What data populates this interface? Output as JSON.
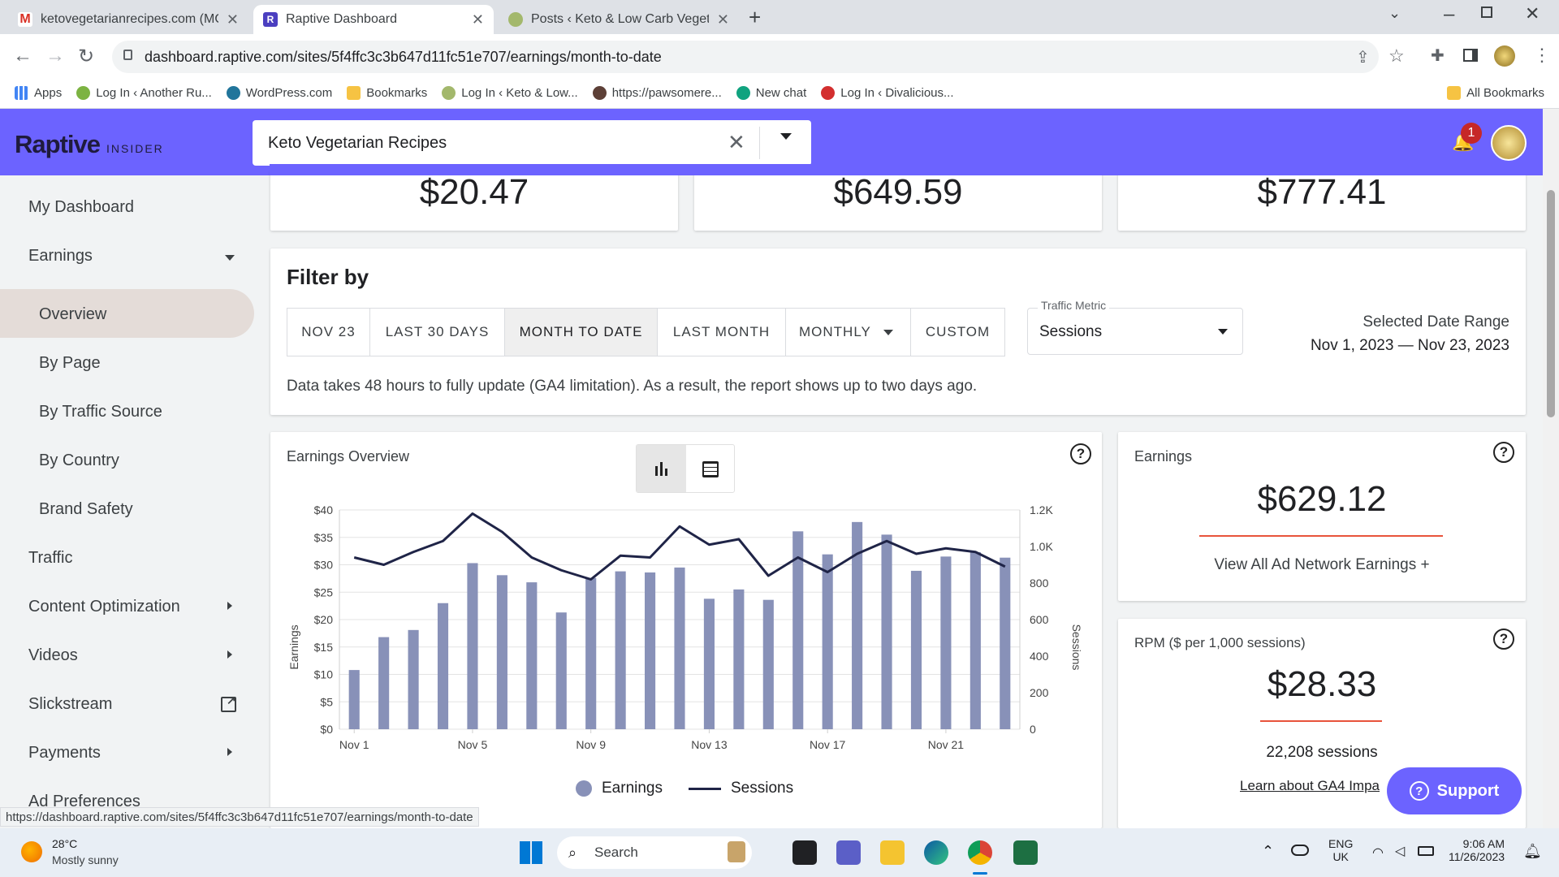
{
  "browser": {
    "tabs": [
      {
        "title": "ketovegetarianrecipes.com (MO",
        "icon": "gmail-icon"
      },
      {
        "title": "Raptive Dashboard",
        "icon": "raptive-icon"
      },
      {
        "title": "Posts ‹ Keto & Low Carb Vegetar",
        "icon": "avocado-icon"
      }
    ],
    "url": "dashboard.raptive.com/sites/5f4ffc3c3b647d11fc51e707/earnings/month-to-date",
    "status_url": "https://dashboard.raptive.com/sites/5f4ffc3c3b647d11fc51e707/earnings/month-to-date",
    "bookmarks": [
      "Apps",
      "Log In ‹ Another Ru...",
      "WordPress.com",
      "Bookmarks",
      "Log In ‹ Keto & Low...",
      "https://pawsomere...",
      "New chat",
      "Log In ‹ Divalicious..."
    ],
    "all_bookmarks": "All Bookmarks"
  },
  "header": {
    "logo": "Raptive",
    "logo_sub": "INSIDER",
    "site_name": "Keto Vegetarian Recipes",
    "notification_count": "1",
    "brand_color": "#6c63ff"
  },
  "sidebar": {
    "items": [
      {
        "label": "My Dashboard"
      },
      {
        "label": "Earnings"
      },
      {
        "label": "Overview"
      },
      {
        "label": "By Page"
      },
      {
        "label": "By Traffic Source"
      },
      {
        "label": "By Country"
      },
      {
        "label": "Brand Safety"
      },
      {
        "label": "Traffic"
      },
      {
        "label": "Content Optimization"
      },
      {
        "label": "Videos"
      },
      {
        "label": "Slickstream"
      },
      {
        "label": "Payments"
      },
      {
        "label": "Ad Preferences"
      }
    ]
  },
  "summary": [
    "$20.47",
    "$649.59",
    "$777.41"
  ],
  "filter": {
    "title": "Filter by",
    "buttons": [
      "NOV 23",
      "LAST 30 DAYS",
      "MONTH TO DATE",
      "LAST MONTH",
      "MONTHLY",
      "CUSTOM"
    ],
    "metric_label": "Traffic Metric",
    "metric_value": "Sessions",
    "range_label": "Selected Date Range",
    "range_value": "Nov 1, 2023 — Nov 23, 2023",
    "note": "Data takes 48 hours to fully update (GA4 limitation). As a result, the report shows up to two days ago."
  },
  "chart_card": {
    "title": "Earnings Overview"
  },
  "chart_data": {
    "type": "bar",
    "categories": [
      "Nov 1",
      "Nov 2",
      "Nov 3",
      "Nov 4",
      "Nov 5",
      "Nov 6",
      "Nov 7",
      "Nov 8",
      "Nov 9",
      "Nov 10",
      "Nov 11",
      "Nov 12",
      "Nov 13",
      "Nov 14",
      "Nov 15",
      "Nov 16",
      "Nov 17",
      "Nov 18",
      "Nov 19",
      "Nov 20",
      "Nov 21",
      "Nov 22",
      "Nov 23"
    ],
    "x_tick_labels": [
      "Nov 1",
      "Nov 5",
      "Nov 9",
      "Nov 13",
      "Nov 17",
      "Nov 21"
    ],
    "series": [
      {
        "name": "Earnings",
        "type": "bar",
        "axis": "left",
        "color": "#8891b8",
        "values": [
          10.8,
          16.8,
          18.1,
          23.0,
          30.3,
          28.1,
          26.8,
          21.3,
          27.6,
          28.8,
          28.6,
          29.5,
          23.8,
          25.5,
          23.6,
          36.1,
          31.9,
          37.8,
          35.5,
          28.9,
          31.5,
          32.3,
          31.3
        ]
      },
      {
        "name": "Sessions",
        "type": "line",
        "axis": "right",
        "color": "#1f2447",
        "values": [
          940,
          900,
          970,
          1030,
          1180,
          1080,
          940,
          870,
          820,
          950,
          940,
          1110,
          1010,
          1040,
          840,
          940,
          860,
          960,
          1030,
          960,
          990,
          970,
          890
        ]
      }
    ],
    "ylabel": "Earnings",
    "y2label": "Sessions",
    "ylim": [
      0,
      40
    ],
    "y2lim": [
      0,
      1200
    ],
    "yticks": [
      "$0",
      "$5",
      "$10",
      "$15",
      "$20",
      "$25",
      "$30",
      "$35",
      "$40"
    ],
    "y2ticks": [
      "0",
      "200",
      "400",
      "600",
      "800",
      "1.0K",
      "1.2K"
    ],
    "grid": true,
    "legend": "bottom"
  },
  "earnings_card": {
    "label": "Earnings",
    "value": "$629.12",
    "link": "View All Ad Network Earnings +"
  },
  "rpm_card": {
    "label": "RPM ($ per 1,000 sessions)",
    "value": "$28.33",
    "sessions": "22,208 sessions",
    "link": "Learn about GA4 Impa"
  },
  "support": {
    "label": "Support"
  },
  "taskbar": {
    "temp": "28°C",
    "weather": "Mostly sunny",
    "search": "Search",
    "lang1": "ENG",
    "lang2": "UK",
    "time": "9:06 AM",
    "date": "11/26/2023"
  }
}
